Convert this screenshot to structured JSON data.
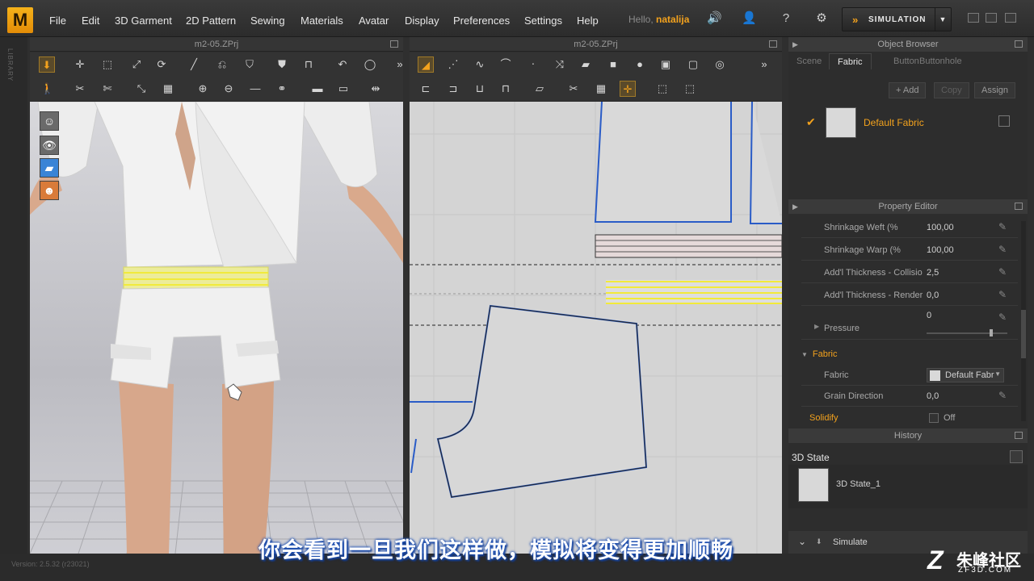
{
  "menu": {
    "logo": "M",
    "items": [
      "File",
      "Edit",
      "3D Garment",
      "2D Pattern",
      "Sewing",
      "Materials",
      "Avatar",
      "Display",
      "Preferences",
      "Settings",
      "Help"
    ],
    "hello_prefix": "Hello,",
    "username": "natalija",
    "simulation_label": "SIMULATION"
  },
  "library_label": "LIBRARY",
  "panels": {
    "view3d_title": "m2-05.ZPrj",
    "view2d_title": "m2-05.ZPrj"
  },
  "object_browser": {
    "title": "Object Browser",
    "tabs": [
      "Scene",
      "Fabric",
      "Button",
      "Buttonhole"
    ],
    "active_tab": "Fabric",
    "add_label": "+ Add",
    "copy_label": "Copy",
    "assign_label": "Assign",
    "fabric_name": "Default Fabric"
  },
  "property_editor": {
    "title": "Property Editor",
    "rows": [
      {
        "label": "Shrinkage Weft (%",
        "value": "100,00"
      },
      {
        "label": "Shrinkage Warp (%",
        "value": "100,00"
      },
      {
        "label": "Add'l Thickness - Collisio",
        "value": "2,5"
      },
      {
        "label": "Add'l Thickness - Renderi",
        "value": "0,0"
      }
    ],
    "pressure_label": "Pressure",
    "pressure_value": "0",
    "pressure_level": 0.78,
    "fabric_section": "Fabric",
    "fabric_label": "Fabric",
    "fabric_value": "Default Fabr",
    "grain_label": "Grain Direction",
    "grain_value": "0,0",
    "solidify_label": "Solidify",
    "solidify_value": "Off"
  },
  "history": {
    "title": "History",
    "state_header": "3D State",
    "state_item": "3D State_1",
    "simulate_label": "Simulate"
  },
  "status": {
    "version": "Version: 2.5.32    (r23021)"
  },
  "subtitle": "你会看到一旦我们这样做，模拟将变得更加顺畅",
  "watermark": {
    "cn": "朱峰社区",
    "en": "ZF3D.COM"
  },
  "colors": {
    "accent": "#f3a21d",
    "pattern_outline": "#2a5cc7",
    "selected_pattern": "#f2ea3a"
  }
}
